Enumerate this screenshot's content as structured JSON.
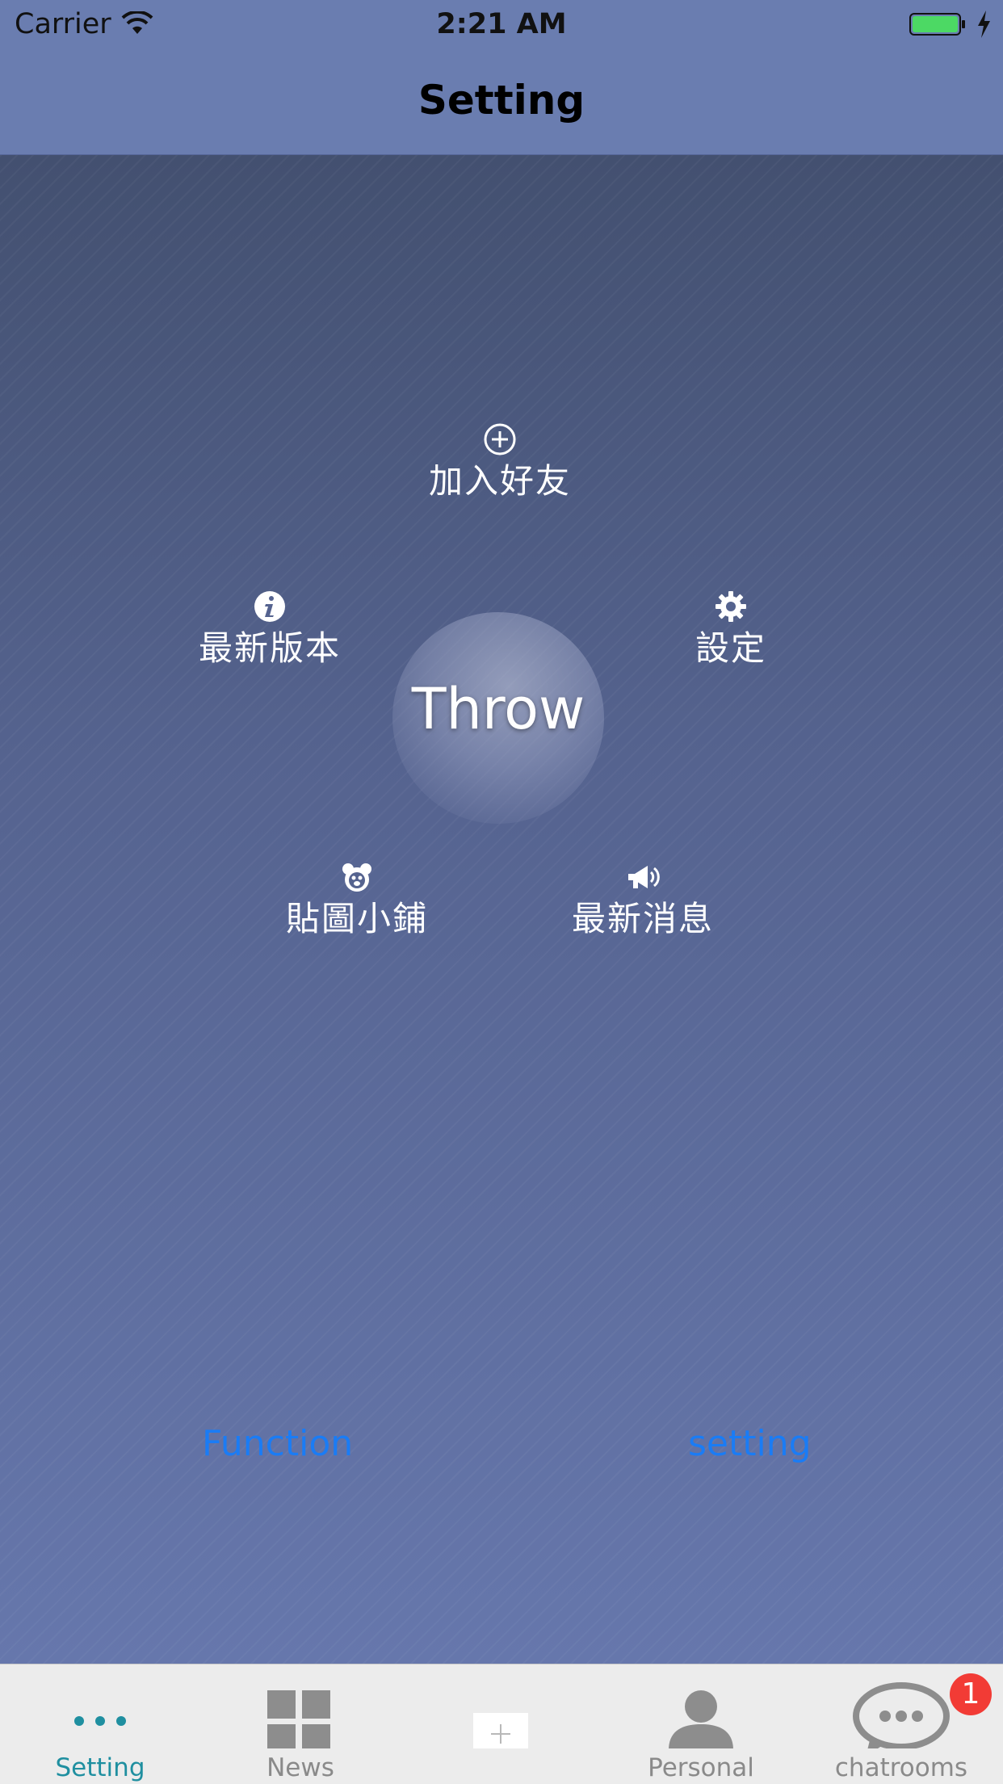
{
  "status_bar": {
    "carrier": "Carrier",
    "time": "2:21 AM"
  },
  "nav": {
    "title": "Setting"
  },
  "menu": {
    "center_label": "Throw",
    "items": [
      {
        "label": "加入好友",
        "icon": "plus-circle-icon"
      },
      {
        "label": "最新版本",
        "icon": "info-icon"
      },
      {
        "label": "設定",
        "icon": "gear-icon"
      },
      {
        "label": "貼圖小鋪",
        "icon": "bear-icon"
      },
      {
        "label": "最新消息",
        "icon": "megaphone-icon"
      }
    ]
  },
  "links": {
    "function_label": "Function",
    "setting_label": "setting"
  },
  "tab_bar": {
    "tabs": [
      {
        "label": "Setting",
        "icon": "more-dots-icon",
        "active": true
      },
      {
        "label": "News",
        "icon": "grid-icon",
        "active": false
      },
      {
        "label": "",
        "icon": "add-icon",
        "active": false
      },
      {
        "label": "Personal",
        "icon": "person-icon",
        "active": false
      },
      {
        "label": "chatrooms",
        "icon": "chat-bubble-icon",
        "active": false
      }
    ],
    "chat_badge": "1"
  },
  "colors": {
    "header_bg": "#6a7db0",
    "link": "#1a7cf5",
    "active_tab": "#1f8fa0",
    "badge": "#f23b35",
    "battery": "#4cd964"
  }
}
